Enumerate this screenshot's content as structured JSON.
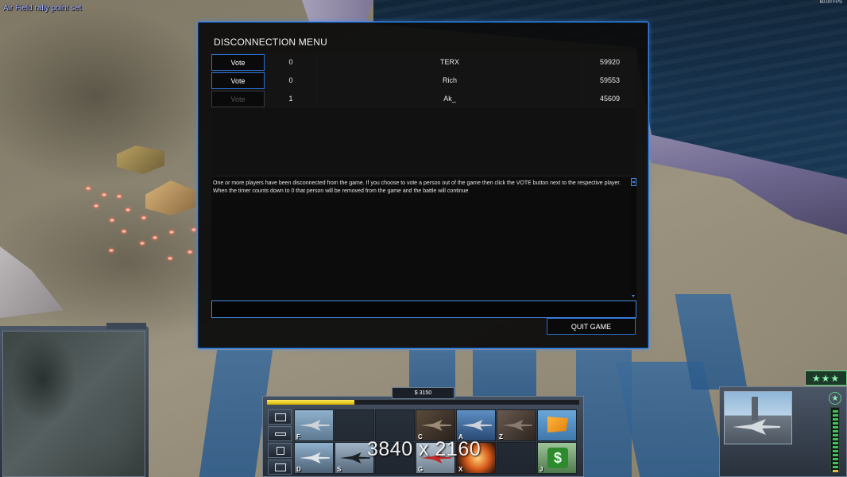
{
  "overlay": {
    "rally_message": "Air Field rally point set",
    "fps": "60.00 FPS",
    "resolution": "3840 x 2160"
  },
  "dialog": {
    "title": "DISCONNECTION MENU",
    "players": [
      {
        "vote_label": "Vote",
        "vote_enabled": true,
        "votes": "0",
        "name": "TERX",
        "ping": "59920"
      },
      {
        "vote_label": "Vote",
        "vote_enabled": true,
        "votes": "0",
        "name": "Rich",
        "ping": "59553"
      },
      {
        "vote_label": "Vote",
        "vote_enabled": false,
        "votes": "1",
        "name": "Ak_",
        "ping": "45609"
      }
    ],
    "message": "One or more players have been disconnected from the game.  If you choose to vote a person out of the game then click the VOTE button next to the respective player.  When the timer counts down to 0 that person will be removed from the game and the battle will continue",
    "chat_input_value": "",
    "quit_label": "QUIT GAME",
    "accent_color": "#3f86e0"
  },
  "hud": {
    "money": "$ 3150",
    "power_fraction": 0.28,
    "side_buttons": [
      "options-icon",
      "wrench-icon",
      "alert-icon",
      "keyboard-icon"
    ],
    "slots_row1": [
      {
        "hotkey": "F",
        "icon": "fighter-jet-icon"
      },
      {
        "hotkey": "",
        "icon": ""
      },
      {
        "hotkey": "",
        "icon": ""
      },
      {
        "hotkey": "C",
        "icon": "aircraft-icon"
      },
      {
        "hotkey": "A",
        "icon": "fighter-jet-icon"
      },
      {
        "hotkey": "Z",
        "icon": "helicopter-icon"
      },
      {
        "hotkey": "",
        "icon": "flag-icon"
      }
    ],
    "slots_row2": [
      {
        "hotkey": "D",
        "icon": "helicopter-icon"
      },
      {
        "hotkey": "S",
        "icon": "stealth-bomber-icon"
      },
      {
        "hotkey": "",
        "icon": ""
      },
      {
        "hotkey": "G",
        "icon": "fighter-jet-icon"
      },
      {
        "hotkey": "X",
        "icon": "explosion-icon"
      },
      {
        "hotkey": "",
        "icon": ""
      },
      {
        "hotkey": "J",
        "icon": "money-icon"
      }
    ],
    "rank": "★★★",
    "veterancy_icon": "★"
  }
}
